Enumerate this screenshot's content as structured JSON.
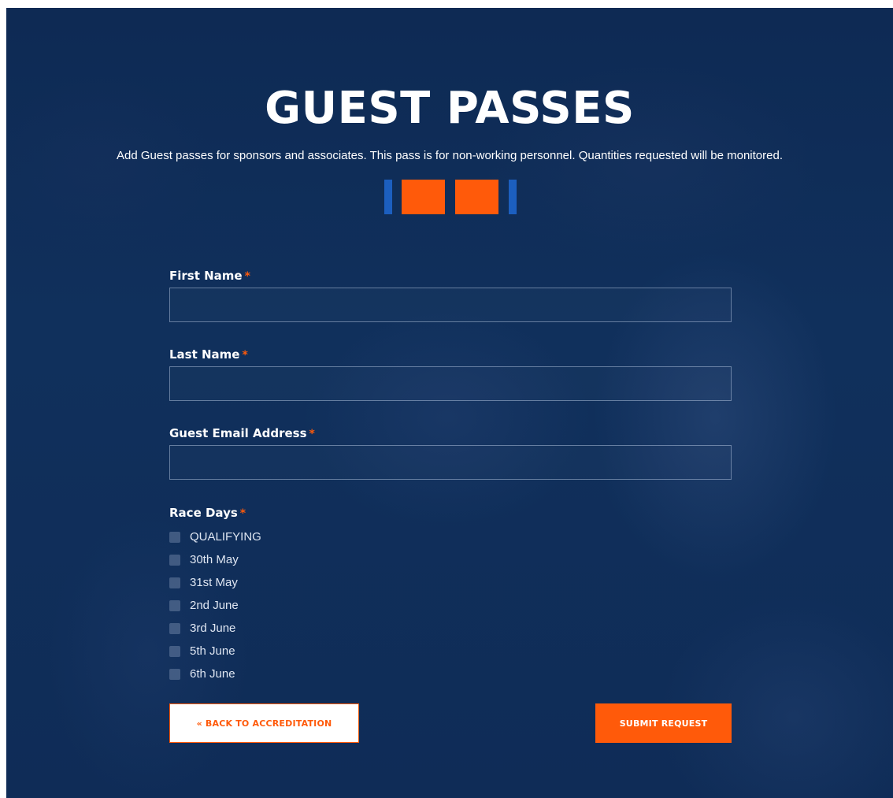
{
  "page": {
    "title": "GUEST PASSES",
    "subtitle": "Add Guest passes for sponsors and associates. This pass is for non-working personnel. Quantities requested will be monitored."
  },
  "progress": {
    "total_steps": 4,
    "active_steps": [
      2,
      3
    ],
    "active_color": "#ff5a0a",
    "inactive_color": "#1c5fbf"
  },
  "form": {
    "first_name": {
      "label": "First Name",
      "required_mark": "*",
      "value": ""
    },
    "last_name": {
      "label": "Last Name",
      "required_mark": "*",
      "value": ""
    },
    "guest_email": {
      "label": "Guest Email Address",
      "required_mark": "*",
      "value": ""
    },
    "race_days": {
      "label": "Race Days",
      "required_mark": "*",
      "options": [
        "QUALIFYING",
        "30th May",
        "31st May",
        "2nd June",
        "3rd June",
        "5th June",
        "6th June"
      ]
    }
  },
  "buttons": {
    "back": "« BACK TO ACCREDITATION",
    "submit": "SUBMIT REQUEST"
  },
  "colors": {
    "background": "#0f2b55",
    "accent": "#ff5a0a",
    "step_blue": "#1c5fbf"
  }
}
